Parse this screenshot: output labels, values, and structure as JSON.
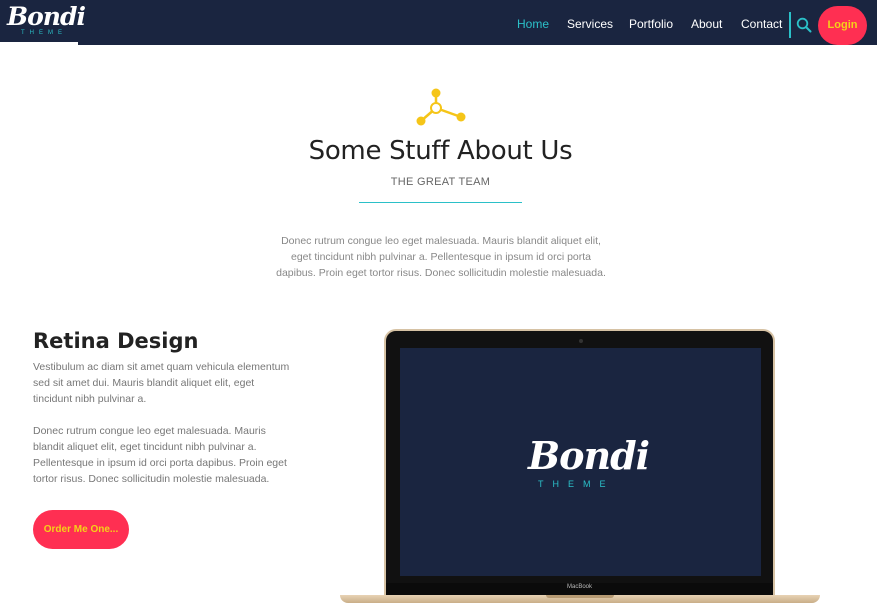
{
  "brand": {
    "name": "Bondi",
    "sub": "THEME"
  },
  "nav": {
    "items": [
      "Home",
      "Services",
      "Portfolio",
      "About",
      "Contact"
    ],
    "active": "Home",
    "search_icon": "search-icon",
    "login_label": "Login"
  },
  "section": {
    "title": "Some Stuff About Us",
    "subtitle": "THE GREAT TEAM",
    "description": "Donec rutrum congue leo eget malesuada. Mauris blandit aliquet elit, eget tincidunt nibh pulvinar a. Pellentesque in ipsum id orci porta dapibus. Proin eget tortor risus. Donec sollicitudin molestie malesuada."
  },
  "feature": {
    "title": "Retina Design",
    "p1": "Vestibulum ac diam sit amet quam vehicula elementum sed sit amet dui. Mauris blandit aliquet elit, eget tincidunt nibh pulvinar a.",
    "p2": "Donec rutrum congue leo eget malesuada. Mauris blandit aliquet elit, eget tincidunt nibh pulvinar a. Pellentesque in ipsum id orci porta dapibus. Proin eget tortor risus. Donec sollicitudin molestie malesuada.",
    "button_label": "Order Me One..."
  },
  "laptop": {
    "brand_label": "MacBook",
    "screen_logo": "Bondi",
    "screen_logo_sub": "THEME"
  },
  "colors": {
    "navy": "#1a2540",
    "teal": "#2bc0c8",
    "accent": "#ff2f52",
    "yellow": "#f5d218",
    "icon_gold": "#f5c518"
  }
}
